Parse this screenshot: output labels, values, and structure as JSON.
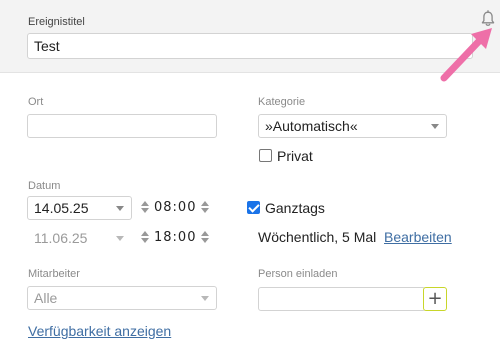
{
  "header": {
    "title_label": "Ereignistitel",
    "title_value": "Test"
  },
  "form": {
    "ort_label": "Ort",
    "ort_value": "",
    "kategorie_label": "Kategorie",
    "kategorie_value": "»Automatisch«",
    "privat_label": "Privat",
    "privat_checked": false,
    "datum_label": "Datum",
    "start_date": "14.05.25",
    "start_time": "08:00",
    "end_date": "11.06.25",
    "end_time": "18:00",
    "ganztags_label": "Ganztags",
    "ganztags_checked": true,
    "recurrence_text": "Wöchentlich, 5 Mal",
    "recurrence_edit_link": "Bearbeiten",
    "mitarbeiter_label": "Mitarbeiter",
    "mitarbeiter_value": "Alle",
    "person_label": "Person einladen",
    "person_value": "",
    "add_button_label": "+",
    "availability_link": "Verfügbarkeit anzeigen"
  },
  "icons": {
    "notification": "bell-icon",
    "annotation": "pink-arrow"
  },
  "colors": {
    "accent_link": "#3f6ea3",
    "checkbox_checked": "#1a73e8",
    "add_button_border": "#c8d62a",
    "annotation_arrow": "#ee6fa8",
    "header_bg": "#f3f3f3"
  }
}
